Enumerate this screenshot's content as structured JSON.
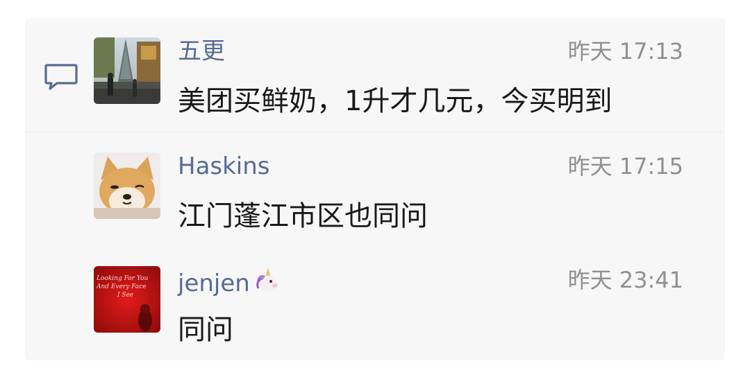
{
  "comments": [
    {
      "author": "五更",
      "time": "昨天 17:13",
      "text": "美团买鲜奶，1升才几元，今买明到",
      "avatar": "christmas-tree-photo"
    },
    {
      "author": "Haskins",
      "time": "昨天 17:15",
      "text": "江门蓬江市区也同问",
      "avatar": "shiba-dog-photo"
    },
    {
      "author": "jenjen",
      "author_emoji": "unicorn-icon",
      "time": "昨天 23:41",
      "text": "同问",
      "avatar": "red-neon-photo",
      "avatar_text": [
        "Looking For You",
        "And Every Face",
        "I See"
      ]
    }
  ],
  "icons": {
    "comment": "comment-icon"
  },
  "colors": {
    "name": "#576b95",
    "time": "#8f8f8f",
    "message": "#191919",
    "panel_bg": "#f7f7f7",
    "icon": "#576b95"
  }
}
